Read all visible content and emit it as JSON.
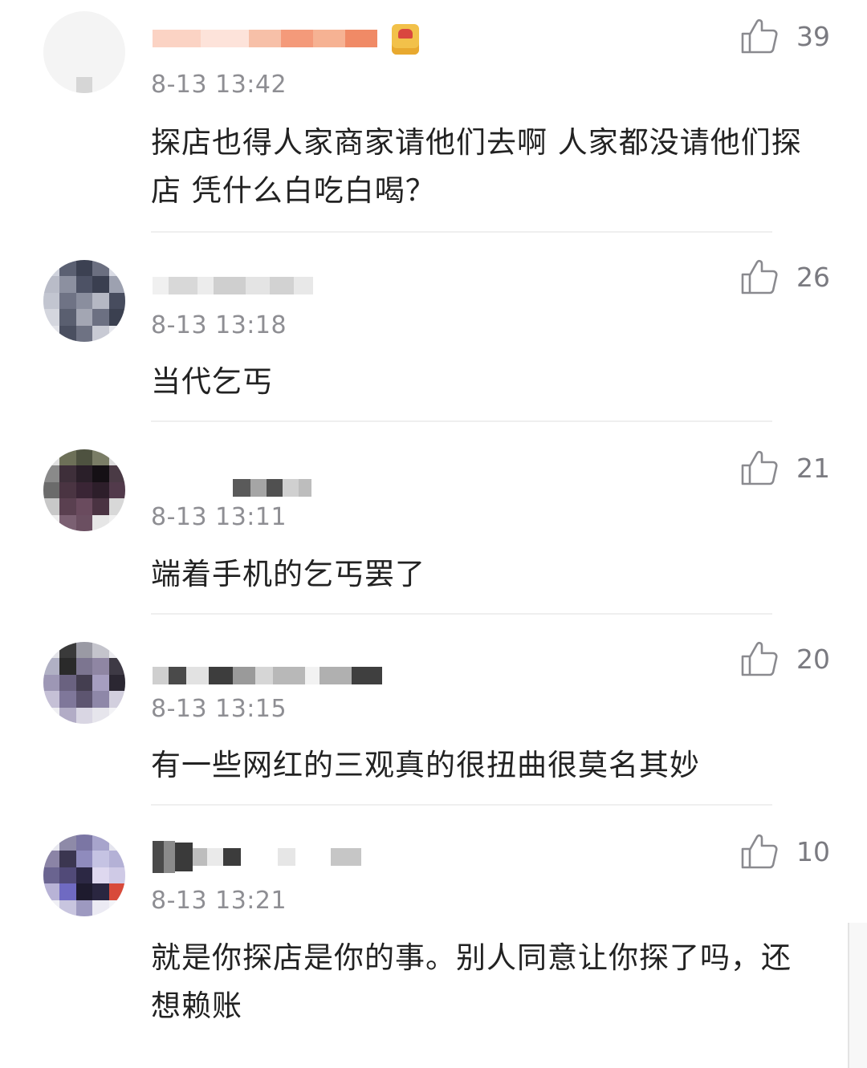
{
  "comments": [
    {
      "time": "8-13 13:42",
      "likes": "39",
      "text": "探店也得人家商家请他们去啊 人家都没请他们探店 凭什么白吃白喝？"
    },
    {
      "time": "8-13 13:18",
      "likes": "26",
      "text": "当代乞丐"
    },
    {
      "time": "8-13 13:11",
      "likes": "21",
      "text": "端着手机的乞丐罢了"
    },
    {
      "time": "8-13 13:15",
      "likes": "20",
      "text": "有一些网红的三观真的很扭曲很莫名其妙"
    },
    {
      "time": "8-13 13:21",
      "likes": "10",
      "text": "就是你探店是你的事。别人同意让你探了吗，还想赖账"
    }
  ],
  "icons": {
    "like": "thumbs-up-icon",
    "badge": "vip-badge-icon"
  }
}
